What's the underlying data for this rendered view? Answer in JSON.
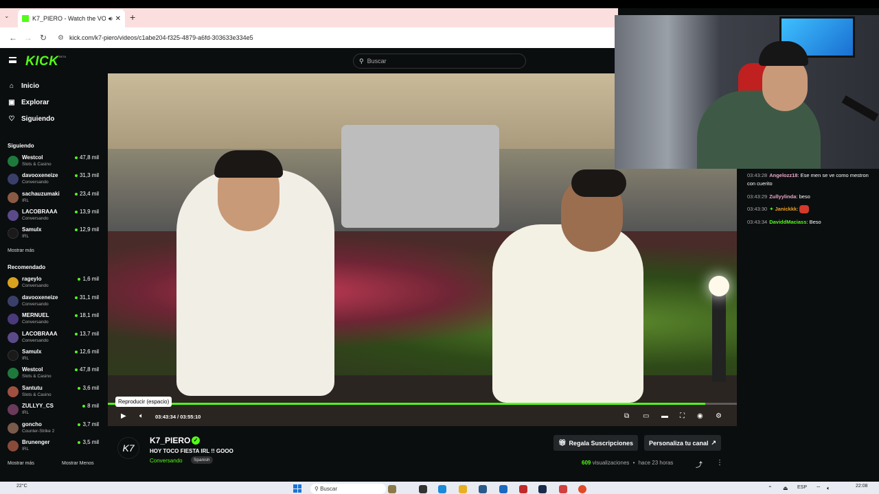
{
  "browser": {
    "tab_title": "K7_PIERO - Watch the VOD",
    "url": "kick.com/k7-piero/videos/c1abe204-f325-4879-a6fd-303633e334e5"
  },
  "header": {
    "logo": "KICK",
    "logo_beta": "BETA",
    "search_placeholder": "Buscar"
  },
  "sidebar": {
    "nav": [
      {
        "label": "Inicio",
        "icon": "home-icon"
      },
      {
        "label": "Explorar",
        "icon": "compass-icon"
      },
      {
        "label": "Siguiendo",
        "icon": "heart-icon"
      }
    ],
    "following_title": "Siguiendo",
    "following": [
      {
        "name": "Westcol",
        "category": "Slots & Casino",
        "viewers": "47,8 mil",
        "color": "#1e7a3c"
      },
      {
        "name": "davooxeneize",
        "category": "Conversando",
        "viewers": "31,3 mil",
        "color": "#3a3f6a"
      },
      {
        "name": "sachauzumaki",
        "category": "IRL",
        "viewers": "23,4 mil",
        "color": "#8a5a44"
      },
      {
        "name": "LACOBRAAA",
        "category": "Conversando",
        "viewers": "13,9 mil",
        "color": "#5b4a8a"
      },
      {
        "name": "Samulx",
        "category": "IRL",
        "viewers": "12,9 mil",
        "color": "#1a1a1a"
      }
    ],
    "following_more": "Mostrar más",
    "recommended_title": "Recomendado",
    "recommended": [
      {
        "name": "rageylo",
        "category": "Conversando",
        "viewers": "1,6 mil",
        "color": "#d9a21e"
      },
      {
        "name": "davooxeneize",
        "category": "Conversando",
        "viewers": "31,1 mil",
        "color": "#3a3f6a"
      },
      {
        "name": "MERNUEL",
        "category": "Conversando",
        "viewers": "18,1 mil",
        "color": "#4a3a7a"
      },
      {
        "name": "LACOBRAAA",
        "category": "Conversando",
        "viewers": "13,7 mil",
        "color": "#5b4a8a"
      },
      {
        "name": "Samulx",
        "category": "IRL",
        "viewers": "12,6 mil",
        "color": "#1a1a1a"
      },
      {
        "name": "Westcol",
        "category": "Slots & Casino",
        "viewers": "47,8 mil",
        "color": "#1e7a3c"
      },
      {
        "name": "Santutu",
        "category": "Slots & Casino",
        "viewers": "3,6 mil",
        "color": "#a05040"
      },
      {
        "name": "ZULLYY_CS",
        "category": "IRL",
        "viewers": "8 mil",
        "color": "#6a3a5a"
      },
      {
        "name": "goncho",
        "category": "Counter-Strike 2",
        "viewers": "3,7 mil",
        "color": "#7a5a4a"
      },
      {
        "name": "Brunenger",
        "category": "IRL",
        "viewers": "3,5 mil",
        "color": "#8a4a3a"
      }
    ],
    "show_more": "Mostrar más",
    "show_less": "Mostrar Menos"
  },
  "player": {
    "tooltip": "Reproducir (espacio)",
    "current_time": "03:43:34",
    "duration": "03:55:10",
    "progress": 0.95
  },
  "chat": {
    "messages": [
      {
        "time": "03:43:28",
        "user": "Angelozz18",
        "user_color": "#e8a8c8",
        "text": "Ese men se ve como mestron con cuerito"
      },
      {
        "time": "03:43:29",
        "user": "Zullyylinda",
        "user_color": "#e8a8c8",
        "text": "beso"
      },
      {
        "time": "03:43:30",
        "user": "Janickkk",
        "user_color": "#f0a020",
        "text": ""
      },
      {
        "time": "03:43:34",
        "user": "DaviddMaciass",
        "user_color": "#53fc18",
        "text": "Beso"
      }
    ]
  },
  "channel": {
    "name": "K7_PIERO",
    "stream_title": "HOY TOCO FIESTA IRL !! GOOO",
    "category": "Conversando",
    "language": "Spanish",
    "gift_button": "Regala Suscripciones",
    "customize_button": "Personaliza tu canal",
    "views_count": "609",
    "views_label": "visualizaciones",
    "separator": "•",
    "time_ago": "hace 23 horas"
  },
  "taskbar": {
    "temperature": "22°C",
    "search": "Buscar",
    "language": "ESP",
    "clock": "22:08"
  }
}
